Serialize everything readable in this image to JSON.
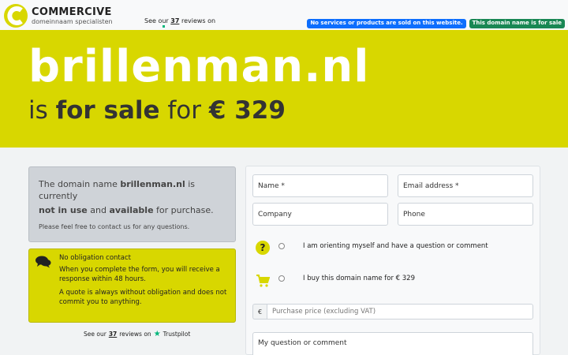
{
  "header": {
    "logo_name": "COMMERCIVE",
    "logo_tagline": "domeinnaam specialisten",
    "reviews_prefix": "See our",
    "reviews_count": "37",
    "reviews_suffix": "reviews on",
    "badge_no_sales": "No services or products are sold on this website.",
    "badge_for_sale": "This domain name is for sale"
  },
  "hero": {
    "domain": "brillenman.nl",
    "sale_prefix": "is",
    "sale_bold": "for sale",
    "sale_for": "for",
    "price": "€ 329"
  },
  "info": {
    "prefix": "The domain name",
    "domain": "brillenman.nl",
    "currently": "is currently",
    "not_in_use": "not in use",
    "and": "and",
    "available": "available",
    "for_purchase": "for purchase.",
    "contact_line": "Please feel free to contact us for any questions."
  },
  "contact": {
    "title": "No obligation contact",
    "text1": "When you complete the form, you will receive a response within 48 hours.",
    "text2": "A quote is always without obligation and does not commit you to anything."
  },
  "bottom_reviews": {
    "prefix": "See our",
    "count": "37",
    "suffix": "reviews on",
    "brand": "Trustpilot"
  },
  "form": {
    "name": "Name *",
    "email": "Email address *",
    "company": "Company",
    "phone": "Phone",
    "option_question": "I am orienting myself and have a question or comment",
    "option_buy": "I buy this domain name for € 329",
    "currency": "€",
    "price_placeholder": "Purchase price (excluding VAT)",
    "question": "My question or comment"
  },
  "colors": {
    "accent_yellow": "#d8d700",
    "badge_blue": "#0d6efd",
    "badge_green": "#198754",
    "trustpilot_green": "#00b67a"
  },
  "icons": [
    "commercive-logo-icon",
    "trustpilot-star-icon",
    "chat-icon",
    "question-icon",
    "cart-icon"
  ]
}
